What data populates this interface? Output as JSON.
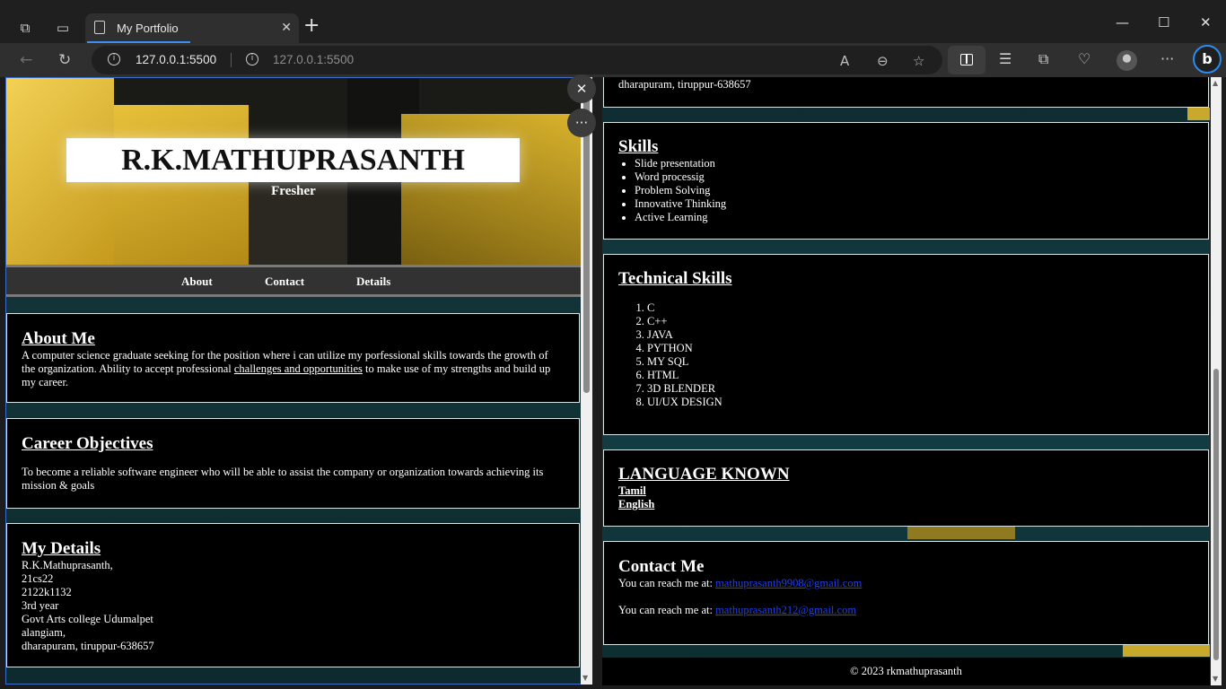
{
  "browser": {
    "tab_title": "My Portfolio",
    "url": "127.0.0.1:5500",
    "url_secondary": "127.0.0.1:5500"
  },
  "hero": {
    "name": "R.K.MATHUPRASANTH",
    "role": "Fresher"
  },
  "nav": {
    "items": [
      {
        "label": "About"
      },
      {
        "label": "Contact"
      },
      {
        "label": "Details"
      }
    ]
  },
  "about": {
    "heading": "About Me",
    "text_before": "A computer science graduate seeking for the position where i can utilize my porfessional skills towards the growth of the organization. Ability to accept professional ",
    "link": "challenges and opportunities",
    "text_after": " to make use of my strengths and build up my career."
  },
  "career": {
    "heading": "Career Objectives",
    "text": "To become a reliable software engineer who will be able to assist the company or organization towards achieving its mission & goals"
  },
  "details": {
    "heading": "My Details",
    "lines": [
      "R.K.Mathuprasanth,",
      "21cs22",
      "2122k1132",
      "3rd year",
      "Govt Arts college Udumalpet",
      "alangiam,",
      "dharapuram, tiruppur-638657"
    ]
  },
  "details_right_tail": "dharapuram, tiruppur-638657",
  "skills": {
    "heading": "Skills",
    "items": [
      "Slide presentation",
      "Word processig",
      "Problem Solving",
      "Innovative Thinking",
      "Active Learning"
    ]
  },
  "technical": {
    "heading": "Technical Skills",
    "items": [
      "C",
      "C++",
      "JAVA",
      "PYTHON",
      "MY SQL",
      "HTML",
      "3D BLENDER",
      "UI/UX DESIGN"
    ]
  },
  "languages": {
    "heading": "LANGUAGE KNOWN",
    "items": [
      "Tamil",
      "English"
    ]
  },
  "contact": {
    "heading": "Contact Me",
    "prefix": "You can reach me at: ",
    "emails": [
      "mathuprasanth9908@gmail.com",
      "mathuprasanth212@gmail.com"
    ]
  },
  "footer": "© 2023 rkmathuprasanth"
}
